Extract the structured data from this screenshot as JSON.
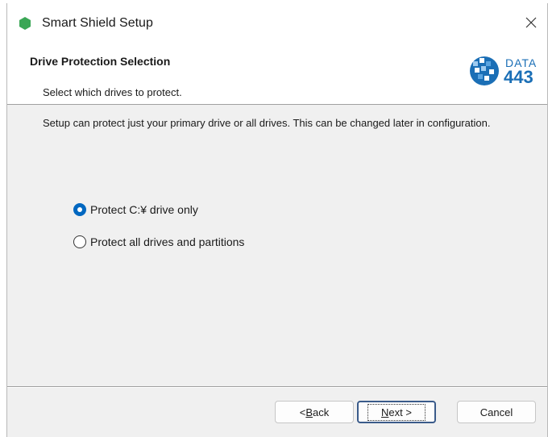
{
  "window": {
    "title": "Smart Shield Setup",
    "app_icon": "green-hexagon-icon",
    "close_icon": "close-icon"
  },
  "header": {
    "title": "Drive Protection Selection",
    "subtitle": "Select which drives to protect.",
    "logo": {
      "line1": "DATA",
      "line2": "443",
      "registered_mark": "®",
      "color": "#1b6fb6"
    }
  },
  "body": {
    "description": "Setup can protect just your primary drive or all drives. This can be changed later in configuration.",
    "options": [
      {
        "label": "Protect C:¥ drive only",
        "checked": true
      },
      {
        "label": "Protect all drives and partitions",
        "checked": false
      }
    ]
  },
  "buttons": {
    "back": {
      "prefix": "< ",
      "mnemonic": "B",
      "rest": "ack"
    },
    "next": {
      "mnemonic": "N",
      "rest": "ext >"
    },
    "cancel": "Cancel"
  },
  "colors": {
    "accent": "#0067c0",
    "app_icon": "#3aa655"
  }
}
